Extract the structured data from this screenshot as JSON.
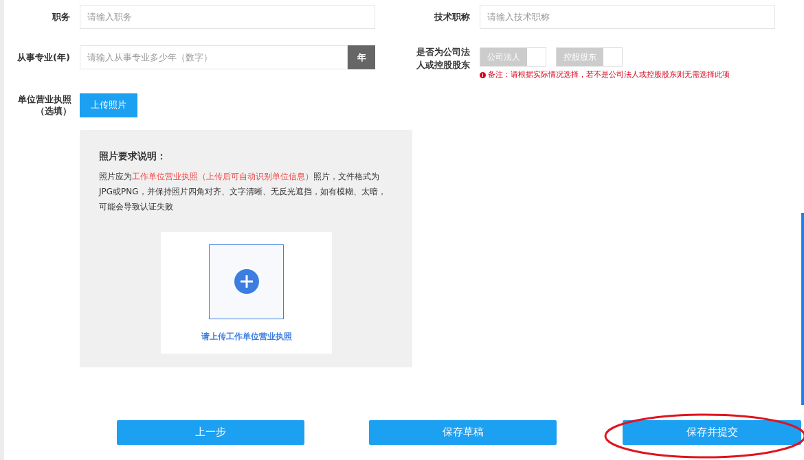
{
  "fields": [
    {
      "label": "职务",
      "placeholder": "请输入职务"
    },
    {
      "label": "技术职称",
      "placeholder": "请输入技术职称"
    }
  ],
  "years": {
    "label": "从事专业(年)",
    "placeholder": "请输入从事专业多少年（数字）",
    "suffix": "年"
  },
  "role": {
    "label": "是否为公司法人或控股股东",
    "toggles": [
      {
        "label": "公司法人",
        "on": false
      },
      {
        "label": "控股股东",
        "on": false
      }
    ],
    "note": "备注：请根据实际情况选择，若不是公司法人或控股股东则无需选择此项"
  },
  "license": {
    "label": "单位营业执照",
    "label_hint": "（选填）",
    "upload_button": "上传照片",
    "requirements_title": "照片要求说明：",
    "requirements": [
      {
        "text": "照片应为",
        "highlight": false
      },
      {
        "text": "工作单位营业执照（上传后可自动识别单位信息）",
        "highlight": true
      },
      {
        "text": "照片，文件格式为JPG或PNG，并保持照片四角对齐、文字清晰、无反光遮挡，如有模糊、太暗，可能会导致认证失败",
        "highlight": false
      }
    ],
    "upload_caption": "请上传工作单位营业执照"
  },
  "buttons": [
    "上一步",
    "保存草稿",
    "保存并提交"
  ]
}
